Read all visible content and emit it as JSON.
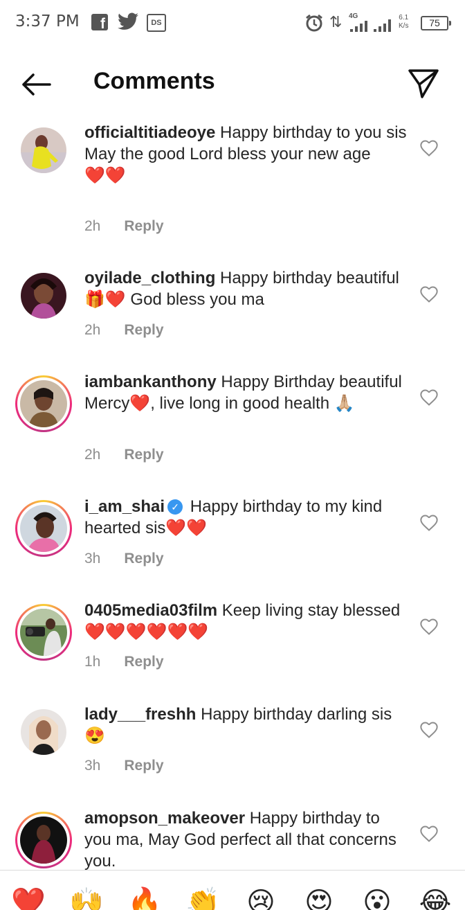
{
  "status_bar": {
    "time": "3:37 PM",
    "icons": [
      "facebook-icon",
      "twitter-icon",
      "ds-icon",
      "alarm-icon",
      "data-arrows-icon",
      "signal-icon",
      "signal-icon",
      "battery-icon"
    ],
    "network": "4G",
    "speed_value": "6.1",
    "speed_unit": "K/s",
    "battery": "75",
    "ds_label": "DS"
  },
  "header": {
    "title": "Comments",
    "back_icon": "arrow-left-icon",
    "share_icon": "paper-plane-icon"
  },
  "comments": [
    {
      "username": "officialtitiadeoye",
      "text": "Happy birthday to you sis",
      "text2": "May the good Lord bless your new age",
      "text3": "❤️❤️",
      "time": "2h",
      "reply": "Reply",
      "story_ring": false
    },
    {
      "username": "oyilade_clothing",
      "text": "Happy birthday beautiful 🎁❤️ God bless you ma",
      "time": "2h",
      "reply": "Reply",
      "story_ring": false
    },
    {
      "username": "iambankanthony",
      "text": "Happy Birthday beautiful Mercy❤️, live long in good health 🙏🏼",
      "time": "2h",
      "reply": "Reply",
      "story_ring": true
    },
    {
      "username": "i_am_shai",
      "verified": true,
      "text": "Happy birthday to my kind hearted sis❤️❤️",
      "time": "3h",
      "reply": "Reply",
      "story_ring": true
    },
    {
      "username": "0405media03film",
      "text": "Keep living stay blessed ❤️❤️❤️❤️❤️❤️",
      "time": "1h",
      "reply": "Reply",
      "story_ring": true
    },
    {
      "username": "lady___freshh",
      "text": "Happy birthday darling sis😍",
      "time": "3h",
      "reply": "Reply",
      "story_ring": false
    },
    {
      "username": "amopson_makeover",
      "text": "Happy birthday to you ma, May God perfect all that concerns you.",
      "time": "",
      "reply": "",
      "story_ring": true
    }
  ],
  "emoji_bar": [
    "❤️",
    "🙌",
    "🔥",
    "👏",
    "😢",
    "😍",
    "😮",
    "😂"
  ],
  "colors": {
    "text": "#262626",
    "meta": "#8e8e8e",
    "verified": "#3897f0",
    "heart": "#e0245e"
  }
}
